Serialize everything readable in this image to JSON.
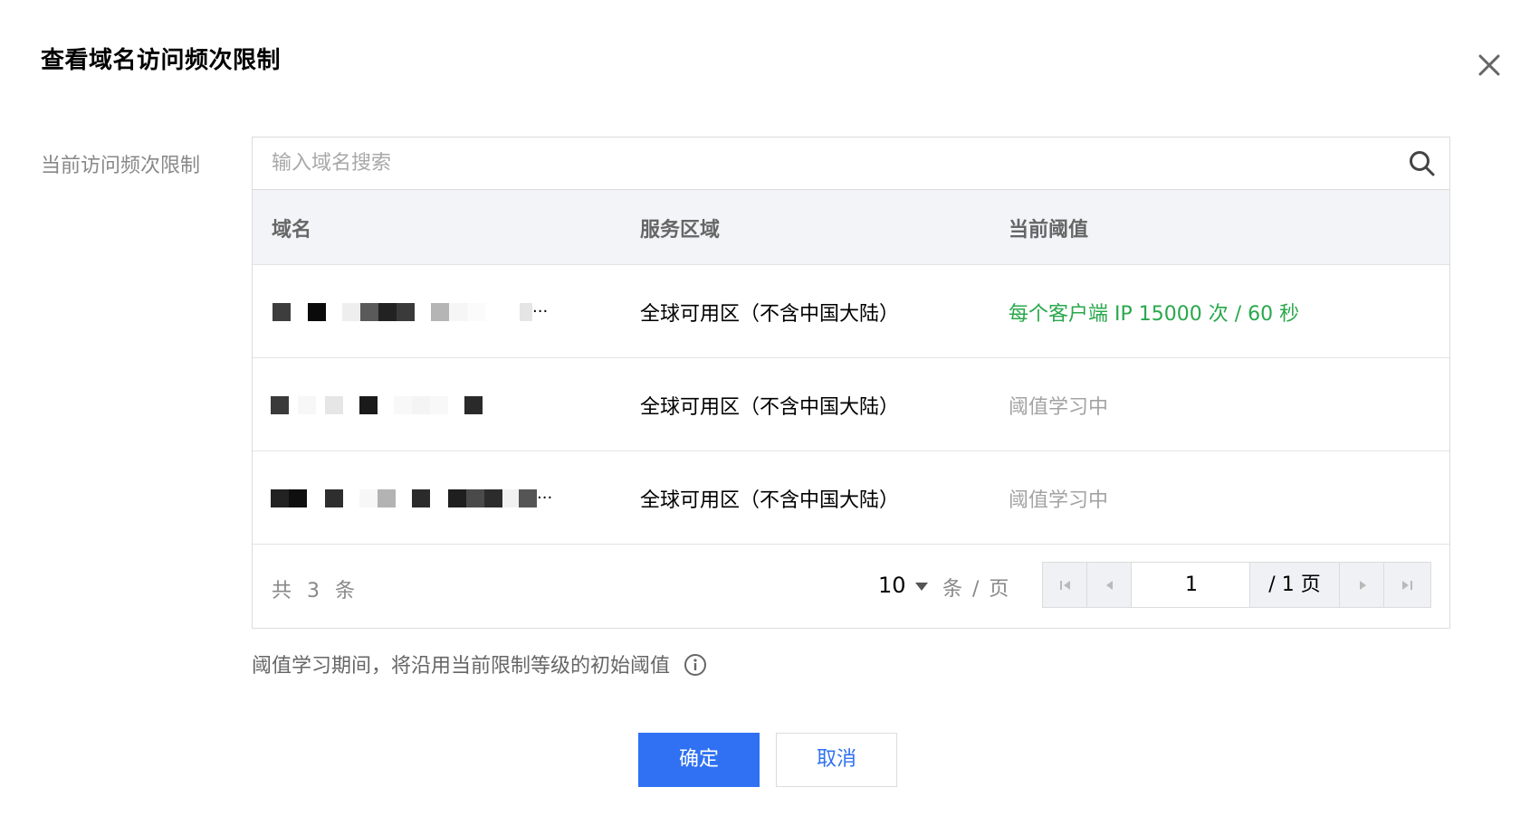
{
  "dialog": {
    "title": "查看域名访问频次限制",
    "close_icon": "close-icon"
  },
  "field": {
    "label": "当前访问频次限制"
  },
  "search": {
    "placeholder": "输入域名搜索",
    "icon": "search-icon"
  },
  "table": {
    "headers": [
      "域名",
      "服务区域",
      "当前阈值"
    ],
    "rows": [
      {
        "domain": "(blurred)",
        "region": "全球可用区（不含中国大陆）",
        "threshold": "每个客户端 IP 15000 次 / 60 秒",
        "threshold_color": "#29a84c"
      },
      {
        "domain": "(blurred)",
        "region": "全球可用区（不含中国大陆）",
        "threshold": "阈值学习中",
        "threshold_color": "#a3a3a3"
      },
      {
        "domain": "(blurred)",
        "region": "全球可用区（不含中国大陆）",
        "threshold": "阈值学习中",
        "threshold_color": "#a3a3a3"
      }
    ]
  },
  "pagination": {
    "total": "共 3 条",
    "page_size": "10",
    "per_page_label": "条 / 页",
    "current_page": "1",
    "total_pages": "/ 1 页"
  },
  "hint": {
    "text": "阈值学习期间，将沿用当前限制等级的初始阈值",
    "icon": "info-icon"
  },
  "buttons": {
    "confirm": "确定",
    "cancel": "取消"
  },
  "colors": {
    "primary": "#2f71f2",
    "success": "#29a84c",
    "muted": "#a3a3a3"
  }
}
